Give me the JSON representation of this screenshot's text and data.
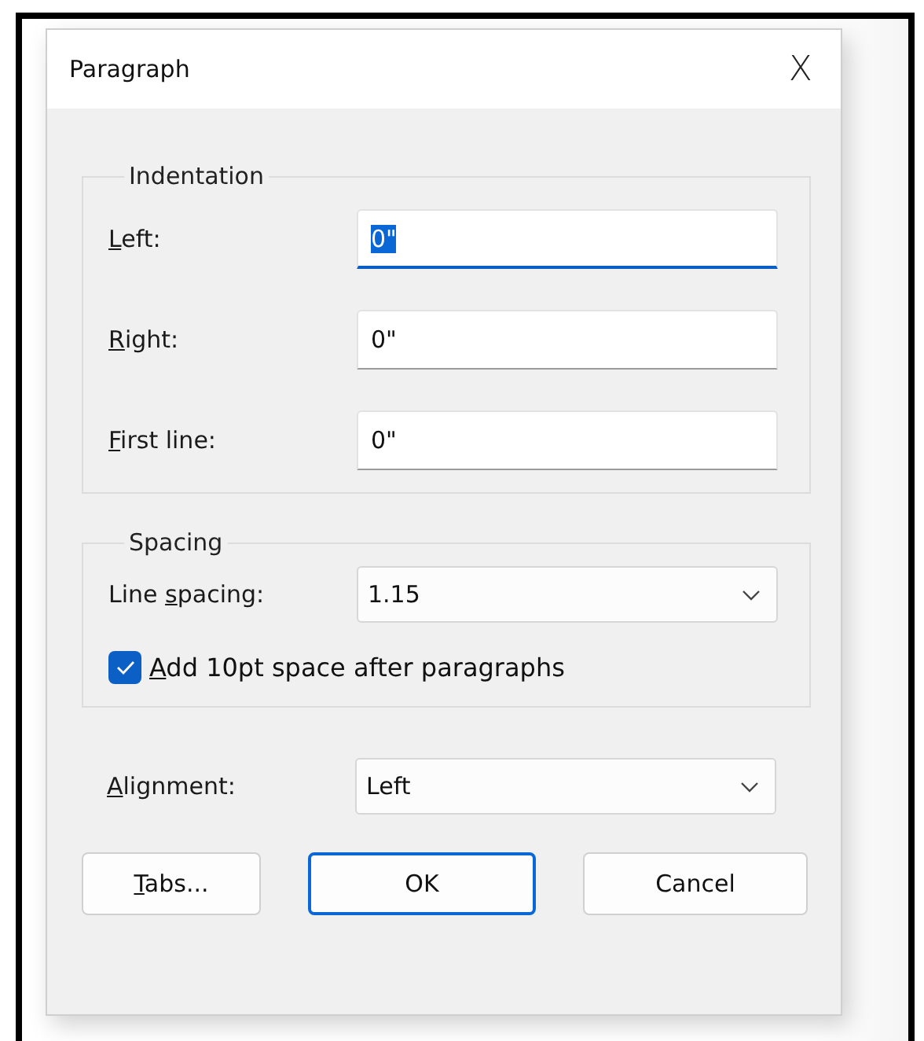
{
  "window": {
    "title": "Paragraph",
    "close": "X"
  },
  "indentation": {
    "title": "Indentation",
    "fields": [
      {
        "label": {
          "key": "L",
          "rest": "eft:"
        },
        "value": "0\"",
        "focused": true
      },
      {
        "label": {
          "key": "R",
          "rest": "ight:"
        },
        "value": "0\"",
        "focused": false
      },
      {
        "label": {
          "key": "F",
          "rest": "irst line:"
        },
        "value": "0\"",
        "focused": false
      }
    ]
  },
  "spacing": {
    "title": "Spacing",
    "line_spacing": {
      "label": {
        "lead": "Line ",
        "key": "s",
        "rest": "pacing:"
      },
      "value": "1.15"
    },
    "add_space": {
      "label": {
        "key": "A",
        "rest": "dd 10pt space after paragraphs"
      },
      "checked": true
    }
  },
  "alignment": {
    "label": {
      "key": "A",
      "rest": "lignment:"
    },
    "value": "Left"
  },
  "buttons": [
    {
      "label": {
        "key": "T",
        "rest": "abs..."
      },
      "default": false
    },
    {
      "label": {
        "rest": "OK"
      },
      "default": true
    },
    {
      "label": {
        "rest": "Cancel"
      },
      "default": false
    }
  ]
}
